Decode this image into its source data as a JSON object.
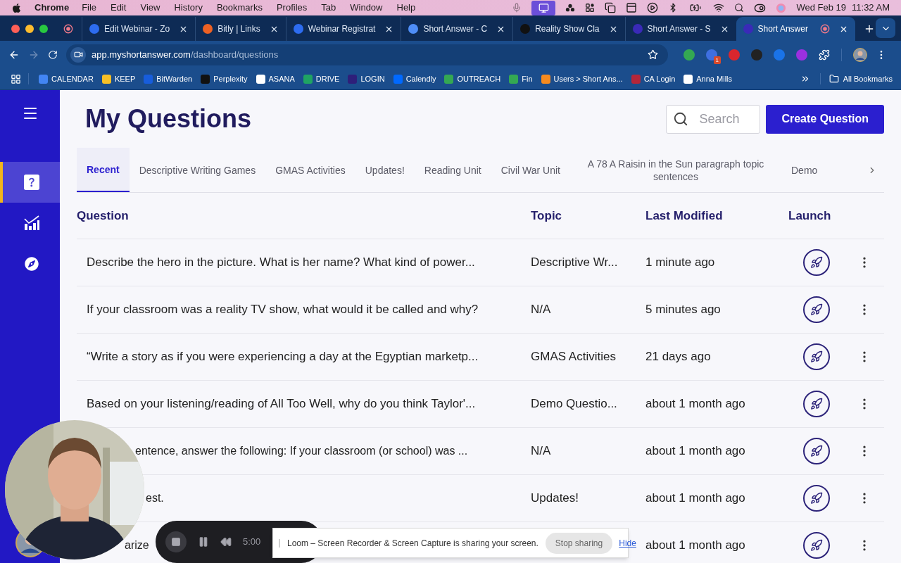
{
  "menu_bar": {
    "app": "Chrome",
    "items": [
      "File",
      "Edit",
      "View",
      "History",
      "Bookmarks",
      "Profiles",
      "Tab",
      "Window",
      "Help"
    ],
    "date": "Wed Feb 19",
    "time": "11:32 AM"
  },
  "browser": {
    "tabs": [
      {
        "title": "Edit Webinar - Zo",
        "color": "#2d6cf0",
        "selected": false
      },
      {
        "title": "Bitly | Links",
        "color": "#ee6123",
        "selected": false
      },
      {
        "title": "Webinar Registrat",
        "color": "#2d6cf0",
        "selected": false
      },
      {
        "title": "Short Answer - C",
        "color": "#4f8ef7",
        "selected": false
      },
      {
        "title": "Reality Show Cla",
        "color": "#111111",
        "selected": false
      },
      {
        "title": "Short Answer - S",
        "color": "#3a2ab8",
        "selected": false
      },
      {
        "title": "Short Answer",
        "color": "#3a2ab8",
        "selected": true
      }
    ],
    "url_host": "app.myshortanswer.com",
    "url_path": "/dashboard/questions",
    "extension_badge": "1",
    "bookmarks": [
      {
        "label": "CALENDAR",
        "color": "#4285f4"
      },
      {
        "label": "KEEP",
        "color": "#f6bf26"
      },
      {
        "label": "BitWarden",
        "color": "#175ddc"
      },
      {
        "label": "Perplexity",
        "color": "#111111"
      },
      {
        "label": "ASANA",
        "color": "#ffffff"
      },
      {
        "label": "DRIVE",
        "color": "#1fa463"
      },
      {
        "label": "LOGIN",
        "color": "#2e1f7a"
      },
      {
        "label": "Calendly",
        "color": "#0069ff"
      },
      {
        "label": "OUTREACH",
        "color": "#34a853"
      },
      {
        "label": "Fin",
        "color": "#34a853"
      },
      {
        "label": "Users > Short Ans...",
        "color": "#f58a1f"
      },
      {
        "label": "CA Login",
        "color": "#b3263a"
      },
      {
        "label": "Anna Mills",
        "color": "#ffffff"
      }
    ],
    "all_bookmarks": "All Bookmarks"
  },
  "sidebar": {
    "items": [
      {
        "kind": "questions",
        "selected": true
      },
      {
        "kind": "reports",
        "selected": false
      },
      {
        "kind": "explore",
        "selected": false
      }
    ]
  },
  "page": {
    "title": "My Questions",
    "search": {
      "placeholder": "Search"
    },
    "create_button": "Create Question",
    "topic_tabs": [
      {
        "label": "Recent",
        "selected": true
      },
      {
        "label": "Descriptive Writing Games",
        "selected": false
      },
      {
        "label": "GMAS Activities",
        "selected": false
      },
      {
        "label": "Updates!",
        "selected": false
      },
      {
        "label": "Reading Unit",
        "selected": false
      },
      {
        "label": "Civil War Unit",
        "selected": false
      },
      {
        "label": "A 78 A Raisin in the Sun paragraph topic sentences",
        "selected": false
      },
      {
        "label": "Demo",
        "selected": false
      }
    ],
    "table": {
      "columns": [
        "Question",
        "Topic",
        "Last Modified",
        "Launch"
      ],
      "rows": [
        {
          "kind": "full",
          "question": "Describe the hero in the picture. What is her name? What kind of power...",
          "topic": "Descriptive Wr...",
          "modified": "1 minute ago"
        },
        {
          "kind": "full",
          "question": "If your classroom was a reality TV show, what would it be called and why?",
          "topic": "N/A",
          "modified": "5 minutes ago"
        },
        {
          "kind": "full",
          "question": "“Write a story as if you were experiencing a day at the Egyptian marketp...",
          "topic": "GMAS Activities",
          "modified": "21 days ago"
        },
        {
          "kind": "full",
          "question": "Based on your listening/reading of All Too Well, why do you think Taylor'...",
          "topic": "Demo Questio...",
          "modified": "about 1 month ago"
        },
        {
          "kind": "covered",
          "question": "entence, answer the following: If your classroom (or school) was ...",
          "topic": "N/A",
          "modified": "about 1 month ago"
        },
        {
          "kind": "covered",
          "question": "est.",
          "topic": "Updates!",
          "modified": "about 1 month ago"
        },
        {
          "kind": "covered",
          "question": "arize",
          "modified": "about 1 month ago"
        }
      ]
    }
  },
  "recorder": {
    "time": "5:00"
  },
  "share_banner": {
    "message": "Loom – Screen Recorder & Screen Capture is sharing your screen.",
    "stop": "Stop sharing",
    "hide": "Hide"
  }
}
